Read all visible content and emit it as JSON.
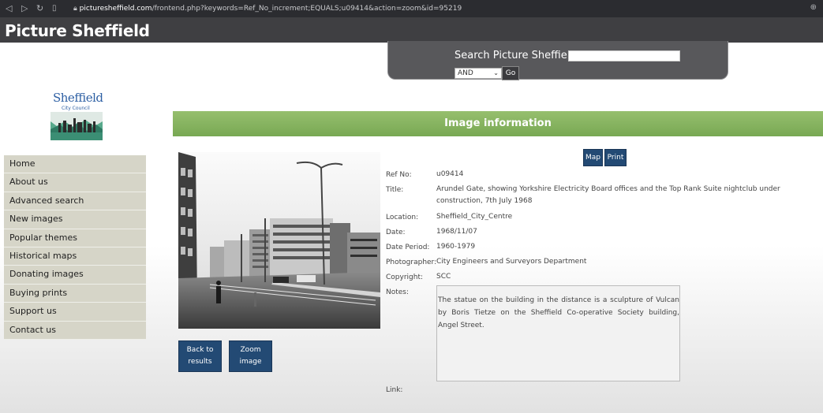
{
  "browser": {
    "url_host": "picturesheffield.com",
    "url_path": "/frontend.php?keywords=Ref_No_increment;EQUALS;u09414&action=zoom&id=95219"
  },
  "site": {
    "title": "Picture Sheffield"
  },
  "search": {
    "label": "Search Picture Sheffield",
    "value": "",
    "operator": "AND",
    "go_label": "Go"
  },
  "logo": {
    "line1": "Sheffield",
    "line2": "City Council"
  },
  "sidebar": {
    "items": [
      {
        "label": "Home"
      },
      {
        "label": "About us"
      },
      {
        "label": "Advanced search"
      },
      {
        "label": "New images"
      },
      {
        "label": "Popular themes"
      },
      {
        "label": "Historical maps"
      },
      {
        "label": "Donating images"
      },
      {
        "label": "Buying prints"
      },
      {
        "label": "Support us"
      },
      {
        "label": "Contact us"
      }
    ]
  },
  "main": {
    "heading": "Image information",
    "map_label": "Map",
    "print_label": "Print",
    "back_label": "Back to results",
    "zoom_label": "Zoom image",
    "fields": [
      {
        "label": "Ref No:",
        "value": "u09414"
      },
      {
        "label": "Title:",
        "value": "Arundel Gate, showing Yorkshire Electricity Board offices and the Top Rank Suite nightclub under construction, 7th July 1968"
      },
      {
        "label": "Location:",
        "value": "Sheffield_City_Centre"
      },
      {
        "label": "Date:",
        "value": "1968/11/07"
      },
      {
        "label": "Date Period:",
        "value": "1960-1979"
      },
      {
        "label": "Photographer:",
        "value": "City Engineers and Surveyors Department"
      },
      {
        "label": "Copyright:",
        "value": "SCC"
      }
    ],
    "notes_label": "Notes:",
    "notes": "The statue on the building in the distance is a sculpture of Vulcan by Boris Tietze on the Sheffield Co-operative Society building, Angel Street.",
    "link_label": "Link:"
  },
  "colors": {
    "header": "#3f3f42",
    "green_bar": "#86b562",
    "button_blue": "#234a74",
    "sidebar_item": "#d6d5c8"
  }
}
